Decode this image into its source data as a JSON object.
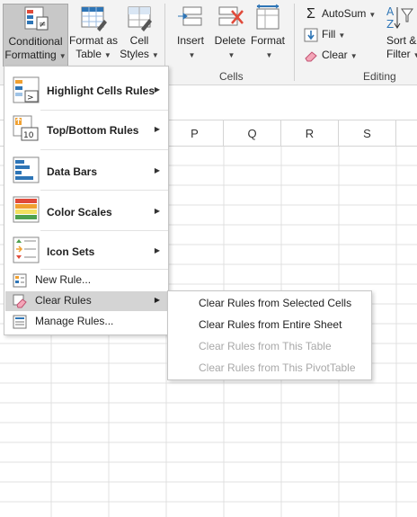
{
  "ribbon": {
    "styles": {
      "conditional_formatting": {
        "line1": "Conditional",
        "line2": "Formatting"
      },
      "format_as_table": {
        "line1": "Format as",
        "line2": "Table"
      },
      "cell_styles": {
        "line1": "Cell",
        "line2": "Styles"
      }
    },
    "cells": {
      "insert": "Insert",
      "delete": "Delete",
      "format": "Format",
      "group_label": "Cells"
    },
    "editing": {
      "autosum": "AutoSum",
      "fill": "Fill",
      "clear": "Clear",
      "sort_line1": "Sort &",
      "sort_line2": "Filter",
      "group_label": "Editing"
    },
    "colors": {
      "accent_blue": "#2e75b6",
      "accent_red": "#e04a3a",
      "accent_orange": "#f0a030"
    }
  },
  "columns": [
    "P",
    "Q",
    "R",
    "S"
  ],
  "cf_menu": {
    "items": [
      {
        "label": "Highlight Cells Rules",
        "icon": "highlight-cells-icon"
      },
      {
        "label": "Top/Bottom Rules",
        "icon": "top-bottom-icon"
      },
      {
        "label": "Data Bars",
        "icon": "data-bars-icon"
      },
      {
        "label": "Color Scales",
        "icon": "color-scales-icon"
      },
      {
        "label": "Icon Sets",
        "icon": "icon-sets-icon"
      }
    ],
    "small_items": [
      {
        "label": "New Rule...",
        "icon": "new-rule-icon"
      },
      {
        "label": "Clear Rules",
        "icon": "clear-rules-icon"
      },
      {
        "label": "Manage Rules...",
        "icon": "manage-rules-icon"
      }
    ]
  },
  "clear_submenu": {
    "items": [
      {
        "label": "Clear Rules from Selected Cells",
        "enabled": true
      },
      {
        "label": "Clear Rules from Entire Sheet",
        "enabled": true
      },
      {
        "label": "Clear Rules from This Table",
        "enabled": false
      },
      {
        "label": "Clear Rules from This PivotTable",
        "enabled": false
      }
    ]
  }
}
